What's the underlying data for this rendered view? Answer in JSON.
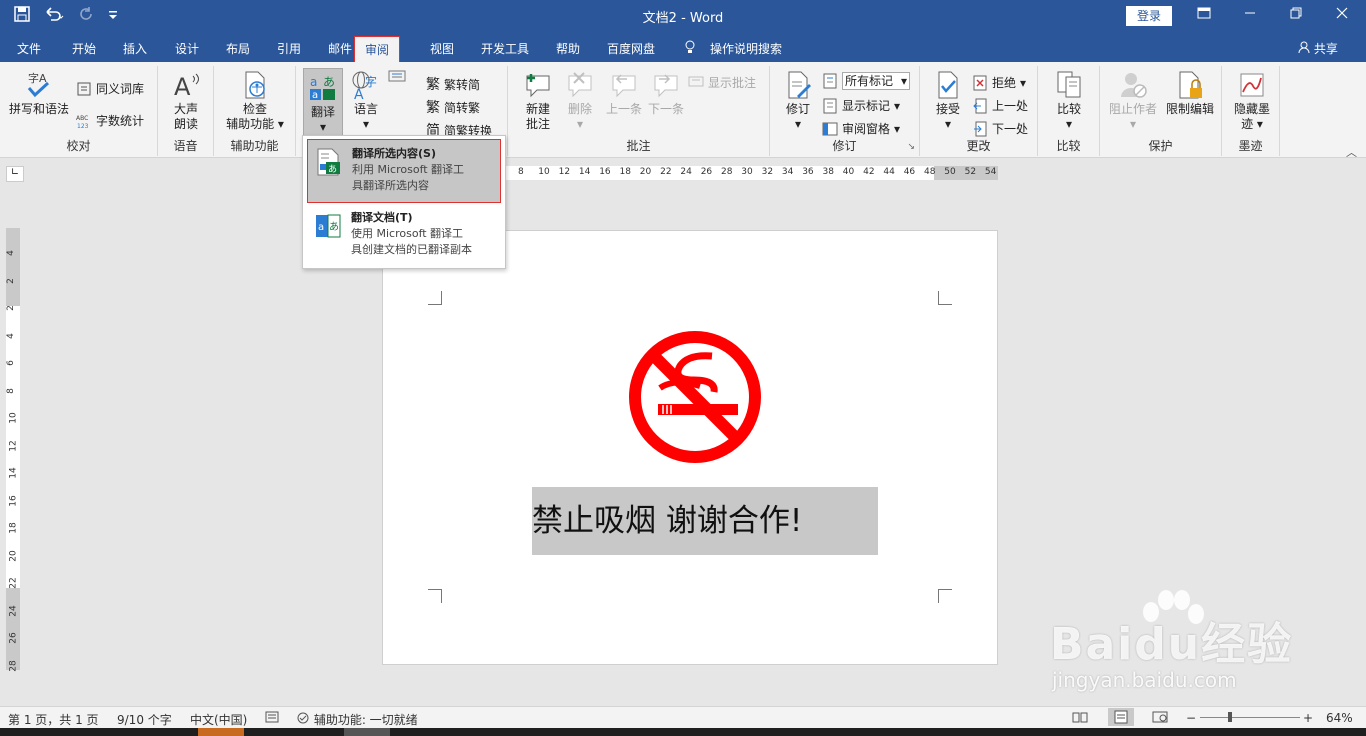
{
  "titlebar": {
    "doc_title": "文档2  -  Word",
    "login_label": "登录",
    "icons": [
      "save-icon",
      "undo-icon",
      "redo-icon",
      "customize-qat-icon",
      "ribbon-display-icon",
      "minimize-icon",
      "restore-icon",
      "close-icon"
    ]
  },
  "tabs": {
    "file": "文件",
    "home": "开始",
    "insert": "插入",
    "design": "设计",
    "layout": "布局",
    "references": "引用",
    "mailings": "邮件",
    "review": "审阅",
    "view": "视图",
    "developer": "开发工具",
    "help": "帮助",
    "baidu": "百度网盘",
    "tellme": "操作说明搜索",
    "share": "共享"
  },
  "ribbon": {
    "proofing": {
      "spell": "拼写和语法",
      "thesaurus": "同义词库",
      "wordcount": "字数统计",
      "group": "校对"
    },
    "speech": {
      "readaloud_1": "大声",
      "readaloud_2": "朗读",
      "group": "语音"
    },
    "accessibility": {
      "check_1": "检查",
      "check_2": "辅助功能",
      "group": "辅助功能"
    },
    "language": {
      "translate": "翻译",
      "language": "语言",
      "to_simplified": "繁转简",
      "to_traditional": "简转繁",
      "convert": "简繁转换"
    },
    "comments": {
      "new_1": "新建",
      "new_2": "批注",
      "delete": "删除",
      "previous": "上一条",
      "next": "下一条",
      "show": "显示批注",
      "group": "批注"
    },
    "tracking": {
      "track": "修订",
      "markup_select": "所有标记",
      "show_markup": "显示标记",
      "review_pane": "审阅窗格",
      "group": "修订"
    },
    "changes": {
      "accept": "接受",
      "reject": "拒绝",
      "previous": "上一处",
      "next": "下一处",
      "group": "更改"
    },
    "compare": {
      "compare": "比较",
      "group": "比较"
    },
    "protect": {
      "block": "阻止作者",
      "restrict": "限制编辑",
      "group": "保护"
    },
    "ink": {
      "hide_1": "隐藏墨",
      "hide_2": "迹",
      "group": "墨迹"
    }
  },
  "menu": {
    "item1_title": "翻译所选内容(S)",
    "item1_desc1": "利用 Microsoft 翻译工",
    "item1_desc2": "具翻译所选内容",
    "item2_title": "翻译文档(T)",
    "item2_desc1": "使用 Microsoft 翻译工",
    "item2_desc2": "具创建文档的已翻译副本"
  },
  "rulers": {
    "horizontal": [
      "8",
      "10",
      "12",
      "14",
      "16",
      "18",
      "20",
      "22",
      "24",
      "26",
      "28",
      "30",
      "32",
      "34",
      "36",
      "38",
      "40",
      "42",
      "44",
      "46",
      "48",
      "50",
      "52",
      "54"
    ],
    "vertical": [
      "4",
      "2",
      "2",
      "4",
      "6",
      "8",
      "10",
      "12",
      "14",
      "16",
      "18",
      "20",
      "22",
      "24",
      "26",
      "28"
    ]
  },
  "document": {
    "caption": "禁止吸烟  谢谢合作!",
    "sign_color": "#ff0000"
  },
  "statusbar": {
    "page": "第 1 页，共 1 页",
    "words": "9/10 个字",
    "language": "中文(中国)",
    "accessibility": "辅助功能: 一切就绪",
    "zoom": "64%",
    "zoom_level": 0.64
  },
  "watermark": {
    "brand": "Baidu经验",
    "domain": "jingyan.baidu.com"
  },
  "colors": {
    "accent": "#2b579a",
    "highlight_border": "#e03030"
  }
}
